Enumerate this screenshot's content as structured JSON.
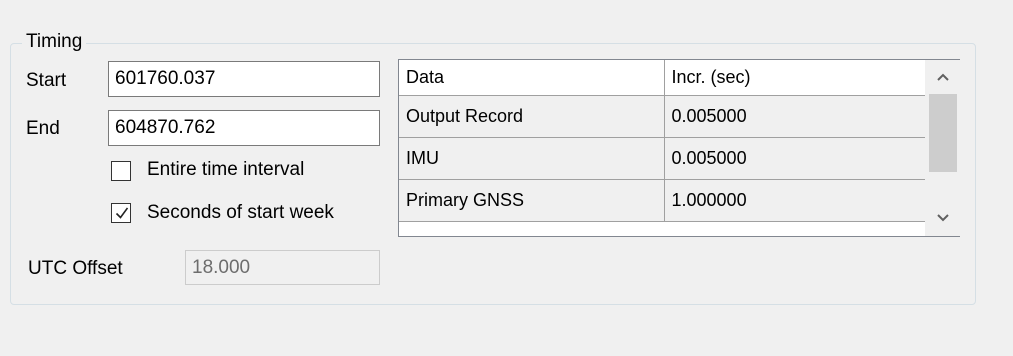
{
  "timing": {
    "group_title": "Timing",
    "start_label": "Start",
    "start_value": "601760.037",
    "end_label": "End",
    "end_value": "604870.762",
    "entire_interval": {
      "label": "Entire time interval",
      "checked": false
    },
    "seconds_of_week": {
      "label": "Seconds of start week",
      "checked": true
    },
    "utc_offset_label": "UTC Offset",
    "utc_offset_value": "18.000",
    "grid": {
      "headers": [
        "Data",
        "Incr. (sec)"
      ],
      "rows": [
        [
          "Output Record",
          "0.005000"
        ],
        [
          "IMU",
          "0.005000"
        ],
        [
          "Primary GNSS",
          "1.000000"
        ]
      ]
    }
  },
  "icons": {
    "scroll_up": "chevron-up-icon",
    "scroll_down": "chevron-down-icon",
    "check": "check-icon"
  }
}
